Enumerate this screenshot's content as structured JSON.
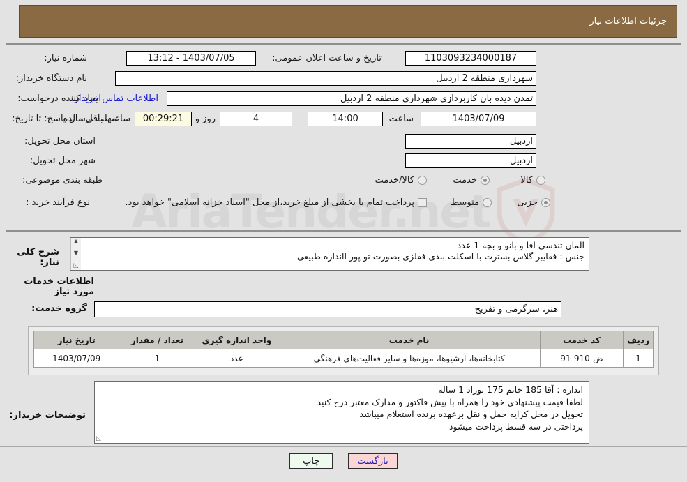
{
  "header": {
    "title": "جزئیات اطلاعات نیاز"
  },
  "watermark": {
    "text": "AriaTender.net"
  },
  "form": {
    "need_number_label": "شماره نیاز:",
    "need_number_value": "1103093234000187",
    "announce_datetime_label": "تاریخ و ساعت اعلان عمومی:",
    "announce_datetime_value": "1403/07/05 - 13:12",
    "buyer_org_label": "نام دستگاه خریدار:",
    "buyer_org_value": "شهرداری منطقه 2 اردبیل",
    "creator_label": "ایجاد کننده درخواست:",
    "creator_value": "تمدن دیده بان کاربردازی شهرداری منطقه 2 اردبیل",
    "contact_link": "اطلاعات تماس خریدار",
    "deadline_label": "مهلت ارسال پاسخ: تا تاریخ:",
    "deadline_date": "1403/07/09",
    "deadline_hour_label": "ساعت",
    "deadline_hour_value": "14:00",
    "remaining_days_value": "4",
    "remaining_days_label": "روز و",
    "remaining_time_value": "00:29:21",
    "remaining_time_label": "ساعت باقی مانده",
    "province_label": "استان محل تحویل:",
    "province_value": "اردبیل",
    "city_label": "شهر محل تحویل:",
    "city_value": "اردبیل",
    "category_label": "طبقه بندی موضوعی:",
    "category_options": [
      {
        "label": "کالا",
        "selected": false
      },
      {
        "label": "خدمت",
        "selected": true
      },
      {
        "label": "کالا/خدمت",
        "selected": false
      }
    ],
    "process_type_label": "نوع فرآیند خرید :",
    "process_type_options": [
      {
        "label": "جزیی",
        "selected": true
      },
      {
        "label": "متوسط",
        "selected": false
      }
    ],
    "treasury_checkbox_label": "پرداخت تمام یا بخشی از مبلغ خرید،از محل \"اسناد خزانه اسلامی\" خواهد بود.",
    "treasury_checked": false
  },
  "description": {
    "label": "شرح کلی نیاز:",
    "text": "المان تندسی  اقا و بانو و بچه   1 عدد\nجنس :  فقایبر گلاس بستر‌ت با اسکلت بندی فقلزی بصورت تو پور ااندازه طبیعی"
  },
  "services": {
    "heading": "اطلاعات خدمات مورد نیاز",
    "group_label": "گروه خدمت:",
    "group_value": "هنر، سرگرمی و تفریح",
    "table": {
      "columns": [
        "ردیف",
        "کد خدمت",
        "نام خدمت",
        "واحد اندازه گیری",
        "تعداد / مقدار",
        "تاریخ نیاز"
      ],
      "rows": [
        [
          "1",
          "ض-910-91",
          "کتابخانه‌ها، آرشیوها، موزه‌ها و سایر فعالیت‌های فرهنگی",
          "عدد",
          "1",
          "1403/07/09"
        ]
      ]
    }
  },
  "buyer_notes": {
    "label": "توضیحات خریدار:",
    "text": "اندازه : آقا 185  خانم 175  نوزاد  1 ساله\nلطفا قیمت پیشنهادی خود را همراه با پیش فاکتور و مدارک معتبر درج کنید\nتحویل در محل کرایه حمل و نقل برعهده برنده استعلام میباشد\nپرداختی در سه قسط پرداخت میشود"
  },
  "footer": {
    "back_button": "بازگشت",
    "print_button": "چاپ"
  },
  "colors": {
    "header_bar": "#8a6a42",
    "page_background": "#e3e3e3",
    "link": "#1414c8",
    "timer_field": "#fbfbe2",
    "back_button": "#fbd6d6",
    "print_button": "#eefaee",
    "table_header": "#cbc9c4"
  }
}
